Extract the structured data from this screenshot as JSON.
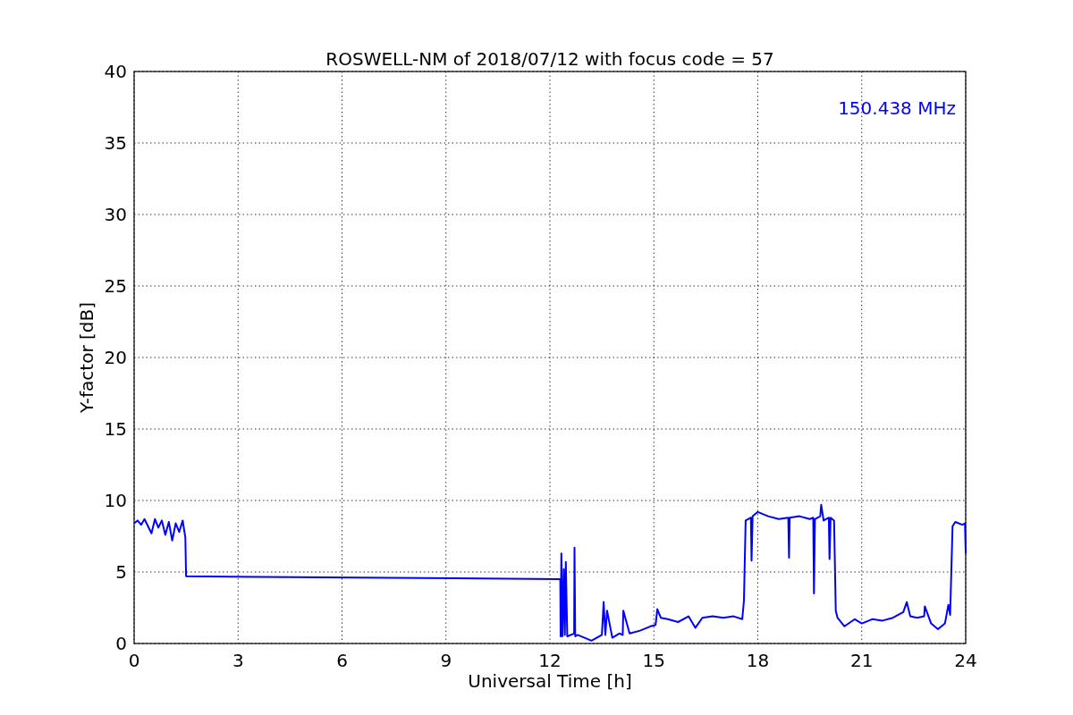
{
  "chart_data": {
    "type": "line",
    "title": "ROSWELL-NM of 2018/07/12 with focus code = 57",
    "xlabel": "Universal Time [h]",
    "ylabel": "Y-factor [dB]",
    "x": [
      0,
      0.1,
      0.2,
      0.3,
      0.4,
      0.5,
      0.6,
      0.7,
      0.8,
      0.9,
      1.0,
      1.1,
      1.2,
      1.3,
      1.4,
      1.48,
      1.5,
      12.3,
      12.31,
      12.33,
      12.36,
      12.4,
      12.43,
      12.46,
      12.5,
      12.7,
      12.71,
      12.73,
      12.8,
      13.0,
      13.2,
      13.5,
      13.55,
      13.6,
      13.65,
      13.8,
      14.0,
      14.1,
      14.12,
      14.3,
      14.6,
      14.9,
      15.05,
      15.1,
      15.2,
      15.4,
      15.7,
      16.0,
      16.2,
      16.4,
      16.7,
      17.0,
      17.3,
      17.55,
      17.6,
      17.65,
      17.8,
      17.82,
      17.85,
      18.0,
      18.3,
      18.6,
      18.88,
      18.9,
      18.92,
      19.2,
      19.5,
      19.6,
      19.62,
      19.65,
      19.8,
      19.83,
      19.9,
      20.05,
      20.07,
      20.1,
      20.2,
      20.25,
      20.3,
      20.5,
      20.8,
      21.0,
      21.3,
      21.6,
      21.9,
      22.2,
      22.3,
      22.4,
      22.6,
      22.8,
      22.82,
      23.0,
      23.2,
      23.4,
      23.5,
      23.55,
      23.62,
      23.7,
      23.9,
      23.98,
      24.0
    ],
    "series": [
      {
        "name": "150.438 MHz",
        "color": "#0000ff",
        "values": [
          8.4,
          8.6,
          8.3,
          8.7,
          8.2,
          7.7,
          8.7,
          8.1,
          8.6,
          7.6,
          8.5,
          7.2,
          8.4,
          7.8,
          8.6,
          7.4,
          4.7,
          4.5,
          0.5,
          6.3,
          0.5,
          5.2,
          0.6,
          5.7,
          0.5,
          0.7,
          6.7,
          0.5,
          0.6,
          0.4,
          0.2,
          0.6,
          2.9,
          0.6,
          2.3,
          0.4,
          0.7,
          0.6,
          2.3,
          0.7,
          0.9,
          1.2,
          1.3,
          2.4,
          1.8,
          1.7,
          1.5,
          1.9,
          1.1,
          1.8,
          1.9,
          1.8,
          1.9,
          1.7,
          3.0,
          8.6,
          8.8,
          5.8,
          8.9,
          9.2,
          8.9,
          8.7,
          8.8,
          6.0,
          8.8,
          8.9,
          8.7,
          8.8,
          3.5,
          8.7,
          8.9,
          9.7,
          8.6,
          8.8,
          5.9,
          8.8,
          8.6,
          2.3,
          1.8,
          1.2,
          1.7,
          1.4,
          1.7,
          1.6,
          1.8,
          2.2,
          2.9,
          1.9,
          1.8,
          1.9,
          2.6,
          1.4,
          1.0,
          1.4,
          2.7,
          2.0,
          8.2,
          8.5,
          8.3,
          8.4,
          6.3
        ]
      }
    ],
    "xlim": [
      0,
      24
    ],
    "ylim": [
      0,
      40
    ],
    "xticks": [
      0,
      3,
      6,
      9,
      12,
      15,
      18,
      21,
      24
    ],
    "yticks": [
      0,
      5,
      10,
      15,
      20,
      25,
      30,
      35,
      40
    ],
    "grid": true
  }
}
